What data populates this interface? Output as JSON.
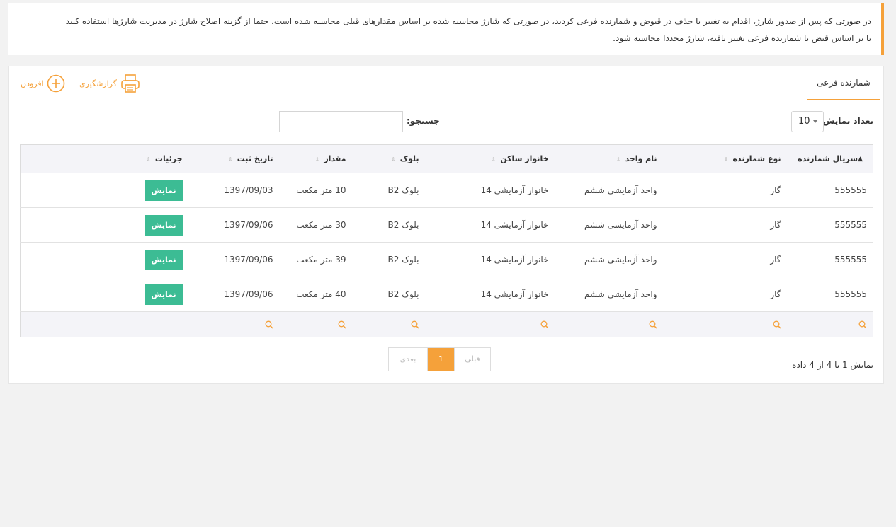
{
  "notice": {
    "line1": "در صورتی که پس از صدور شارژ، اقدام به تغییر یا حذف در قبوض و شمارنده فرعی کردید، در صورتی که شارژ محاسبه شده بر اساس مقدارهای قبلی محاسبه شده است، حتما از گزینه اصلاح شارژ در مدیریت شارژها استفاده کنید",
    "line2": "تا بر اساس قبض یا شمارنده فرعی تغییر یافته، شارژ مجددا محاسبه شود."
  },
  "panel": {
    "tab_label": "شمارنده فرعی",
    "print_label": "گزارشگیری",
    "add_label": "افزودن"
  },
  "controls": {
    "length_label": "تعداد نمایش",
    "length_value": "10",
    "search_label": "جستجو:",
    "search_value": ""
  },
  "table": {
    "columns": [
      "سریال شمارنده",
      "نوع شمارنده",
      "نام واحد",
      "خانوار ساکن",
      "بلوک",
      "مقدار",
      "تاریخ ثبت",
      "جزئیات"
    ],
    "sorted_column": "سریال شمارنده",
    "rows": [
      {
        "serial": "555555",
        "type": "گاز",
        "unit": "واحد آزمایشی ششم",
        "family": "خانوار آزمایشی 14",
        "block": "بلوک B2",
        "amount": "10 متر مکعب",
        "date": "1397/09/03",
        "action": "نمایش"
      },
      {
        "serial": "555555",
        "type": "گاز",
        "unit": "واحد آزمایشی ششم",
        "family": "خانوار آزمایشی 14",
        "block": "بلوک B2",
        "amount": "30 متر مکعب",
        "date": "1397/09/06",
        "action": "نمایش"
      },
      {
        "serial": "555555",
        "type": "گاز",
        "unit": "واحد آزمایشی ششم",
        "family": "خانوار آزمایشی 14",
        "block": "بلوک B2",
        "amount": "39 متر مکعب",
        "date": "1397/09/06",
        "action": "نمایش"
      },
      {
        "serial": "555555",
        "type": "گاز",
        "unit": "واحد آزمایشی ششم",
        "family": "خانوار آزمایشی 14",
        "block": "بلوک B2",
        "amount": "40 متر مکعب",
        "date": "1397/09/06",
        "action": "نمایش"
      }
    ]
  },
  "footer": {
    "info": "نمایش 1 تا 4 از 4 داده",
    "prev_label": "قبلی",
    "current_page": "1",
    "next_label": "بعدی"
  },
  "colors": {
    "accent": "#f5a13a",
    "action_button": "#3cbc94"
  },
  "icons": {
    "print": "printer-icon",
    "add": "plus-circle-icon",
    "filter": "search-icon",
    "sort": "sort-arrows-icon"
  }
}
